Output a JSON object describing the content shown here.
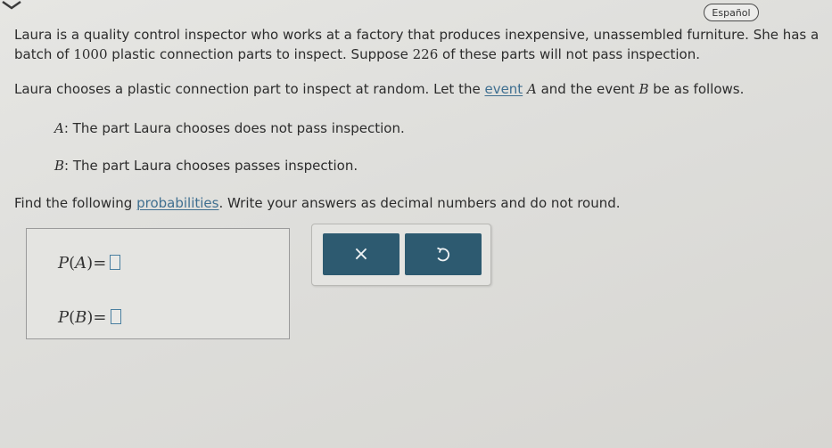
{
  "header": {
    "language_button": "Español"
  },
  "problem": {
    "p1_line1": "Laura is a quality control inspector who works at a factory that produces inexpensive, unassembled furniture. She has a",
    "p1_line2_a": "batch of ",
    "p1_line2_num1": "1000",
    "p1_line2_b": " plastic connection parts to inspect. Suppose ",
    "p1_line2_num2": "226",
    "p1_line2_c": " of these parts will not pass inspection.",
    "p2_a": "Laura chooses a plastic connection part to inspect at random. Let the ",
    "p2_link": "event",
    "p2_var_a": "A",
    "p2_b": " and the event ",
    "p2_var_b": "B",
    "p2_c": " be as follows.",
    "event_a_var": "A",
    "event_a_text": ": The part Laura chooses does not pass inspection.",
    "event_b_var": "B",
    "event_b_text": ": The part Laura chooses passes inspection.",
    "p3_a": "Find the following ",
    "p3_link": "probabilities",
    "p3_b": ". Write your answers as decimal numbers and do not round."
  },
  "answers": {
    "pa_prefix": "P",
    "pa_open": "(",
    "pa_var": "A",
    "pa_close": ")",
    "pa_eq": "=",
    "pa_value": "",
    "pb_prefix": "P",
    "pb_open": "(",
    "pb_var": "B",
    "pb_close": ")",
    "pb_eq": "=",
    "pb_value": ""
  },
  "actions": {
    "clear_symbol": "×",
    "undo_icon": "undo-icon"
  },
  "colors": {
    "button_bg": "#2d5a70",
    "link": "#3f6f90",
    "blank_border": "#4a7fa0"
  }
}
